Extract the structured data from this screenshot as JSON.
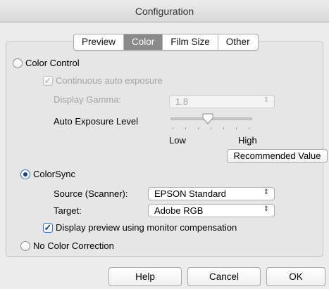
{
  "window": {
    "title": "Configuration"
  },
  "tabs": [
    {
      "label": "Preview",
      "active": false
    },
    {
      "label": "Color",
      "active": true
    },
    {
      "label": "Film Size",
      "active": false
    },
    {
      "label": "Other",
      "active": false
    }
  ],
  "color_control": {
    "label": "Color Control",
    "selected": false,
    "continuous_auto_exposure": {
      "label": "Continuous auto exposure",
      "checked": true,
      "enabled": false
    },
    "display_gamma": {
      "label": "Display Gamma:",
      "value": "1.8",
      "enabled": false
    },
    "auto_exposure": {
      "label": "Auto Exposure Level",
      "low_label": "Low",
      "high_label": "High",
      "level_fraction": 0.45
    },
    "recommended_button": "Recommended Value"
  },
  "colorsync": {
    "label": "ColorSync",
    "selected": true,
    "source": {
      "label": "Source (Scanner):",
      "value": "EPSON Standard"
    },
    "target": {
      "label": "Target:",
      "value": "Adobe RGB"
    },
    "monitor_compensation": {
      "label": "Display preview using monitor compensation",
      "checked": true
    }
  },
  "no_color_correction": {
    "label": "No Color Correction",
    "selected": false
  },
  "footer": {
    "help": "Help",
    "cancel": "Cancel",
    "ok": "OK"
  },
  "colors": {
    "accent": "#3a73c9",
    "tab_active": "#8a8a8a",
    "window_bg": "#ececec"
  },
  "icons": {
    "select_arrow": "updown-chevron-icon",
    "check": "checkmark-icon"
  }
}
